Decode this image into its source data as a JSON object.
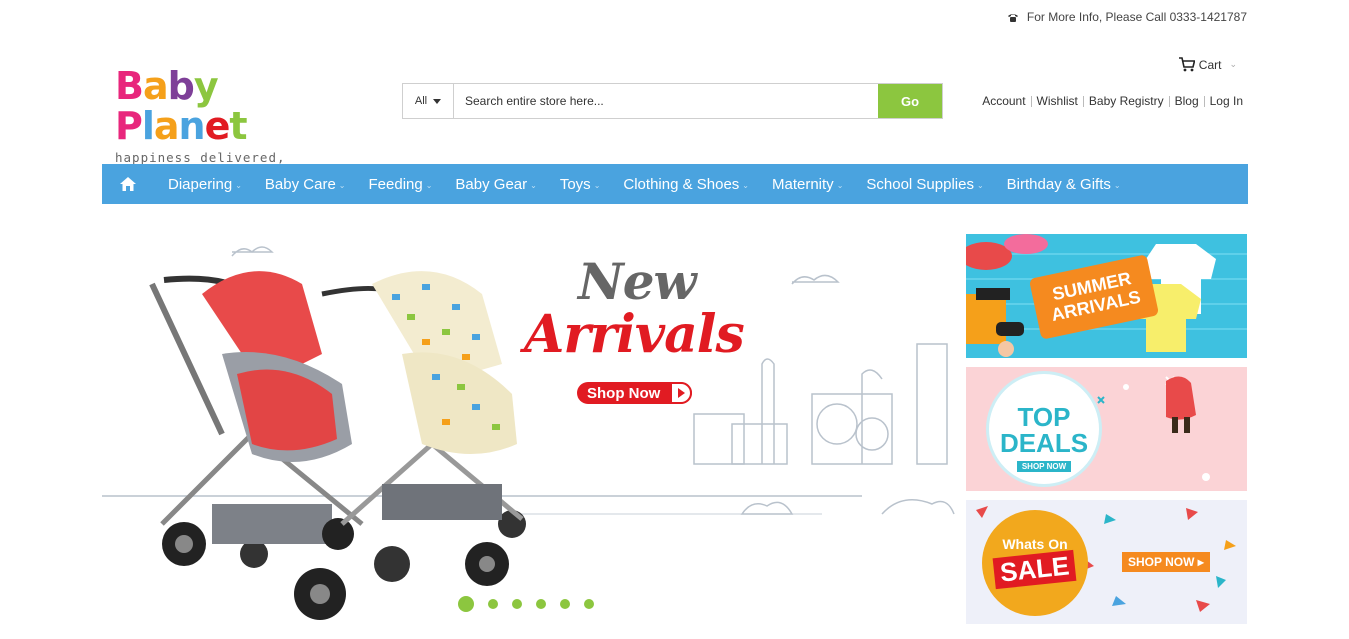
{
  "top_bar": {
    "info": "For More Info, Please Call 0333-1421787"
  },
  "logo": {
    "word1": "Baby",
    "word2": "Planet",
    "tagline": "happiness delivered, everytime"
  },
  "search": {
    "category": "All",
    "placeholder": "Search entire store here...",
    "button": "Go"
  },
  "cart": {
    "label": "Cart"
  },
  "account_links": [
    "Account",
    "Wishlist",
    "Baby Registry",
    "Blog",
    "Log In"
  ],
  "nav": {
    "items": [
      "Diapering",
      "Baby Care",
      "Feeding",
      "Baby Gear",
      "Toys",
      "Clothing & Shoes",
      "Maternity",
      "School Supplies",
      "Birthday & Gifts"
    ]
  },
  "hero": {
    "line1": "New",
    "line2": "Arrivals",
    "cta": "Shop Now",
    "slides": 6,
    "active_slide": 1
  },
  "banners": {
    "summer": {
      "line1": "SUMMER",
      "line2": "ARRIVALS"
    },
    "deals": {
      "line1": "TOP",
      "line2": "DEALS",
      "cta": "SHOP NOW"
    },
    "sale": {
      "line1": "Whats On",
      "line2": "SALE",
      "cta": "SHOP NOW"
    }
  },
  "colors": {
    "nav": "#4aa3df",
    "go": "#8cc63f",
    "brand_red": "#e11b22"
  }
}
